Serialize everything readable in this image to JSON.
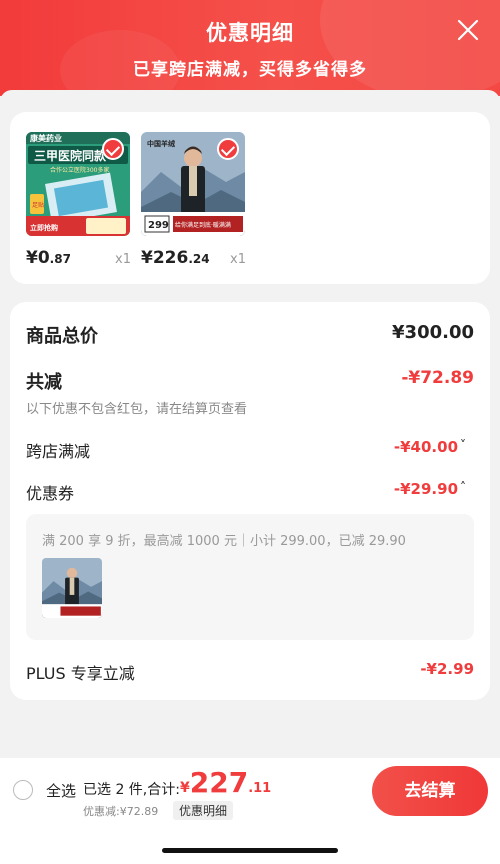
{
  "header": {
    "title": "优惠明细",
    "subtitle": "已享跨店满减，买得多省得多"
  },
  "products": [
    {
      "price_int": "¥0",
      "price_dec": ".87",
      "qty": "x1",
      "thumb_texts": [
        "康美药业",
        "三甲医院同款",
        "合作公立医院300多家",
        "足贴",
        "立即抢购"
      ]
    },
    {
      "price_int": "¥226",
      "price_dec": ".24",
      "qty": "x1",
      "thumb_texts": [
        "中国羊绒",
        "299",
        "给你满足到底·暖满满"
      ]
    }
  ],
  "summary": {
    "total_label": "商品总价",
    "total_value": "¥300.00",
    "discount_label": "共减",
    "discount_value": "-¥72.89",
    "discount_note": "以下优惠不包含红包，请在结算页查看",
    "cross_store_label": "跨店满减",
    "cross_store_value": "-¥40.00",
    "cross_store_chevron": "˅",
    "coupon_label": "优惠券",
    "coupon_value": "-¥29.90",
    "coupon_chevron": "˄",
    "coupon_desc": "满 200 享 9 折，最高减 1000 元｜小计 299.00，已减 29.90",
    "plus_label": "PLUS 专享立减",
    "plus_value": "-¥2.99"
  },
  "bottom": {
    "select_all": "全选",
    "selected_info": "已选 2 件,合计:",
    "total_yen": "¥",
    "total_int": "227",
    "total_dec": ".11",
    "saved": "优惠减:¥72.89",
    "detail_chip": "优惠明细",
    "checkout": "去结算"
  },
  "colors": {
    "accent": "#f03c3c",
    "header_bg": "#f23b3b"
  }
}
